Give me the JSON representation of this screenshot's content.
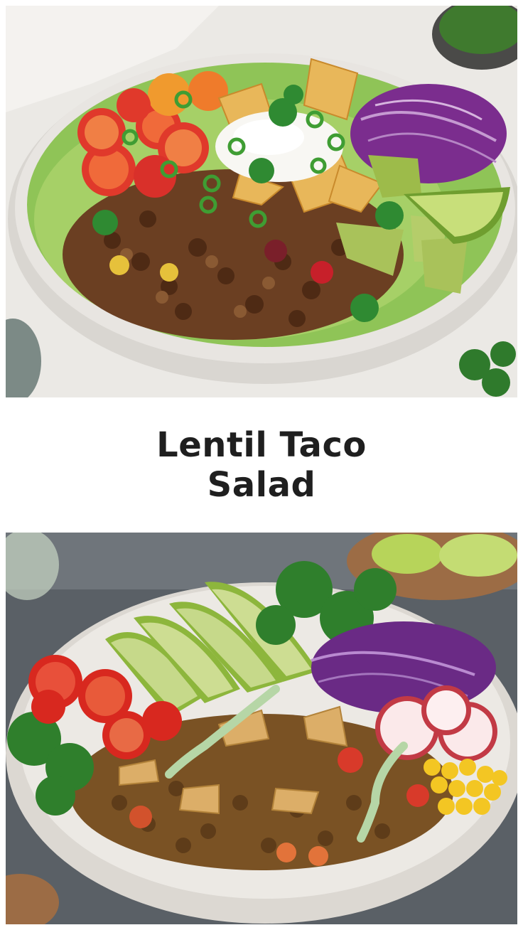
{
  "title": "Lentil Taco Salad",
  "images": [
    {
      "id": "top",
      "subject": "lentil-taco-salad-bowl-overhead"
    },
    {
      "id": "bottom",
      "subject": "lentil-taco-salad-bowl-closeup"
    }
  ],
  "colors": {
    "background": "#ffffff",
    "title_text": "#1f1f1f",
    "lentil": "#6b3f22",
    "lettuce": "#8fc457",
    "tomato": "#e0392b",
    "cabbage": "#7b2d8e",
    "avocado": "#9dbb4a",
    "lime": "#b7d45a",
    "chip": "#e8b75a",
    "corn": "#f3c623",
    "bowl": "#e6e3de"
  }
}
